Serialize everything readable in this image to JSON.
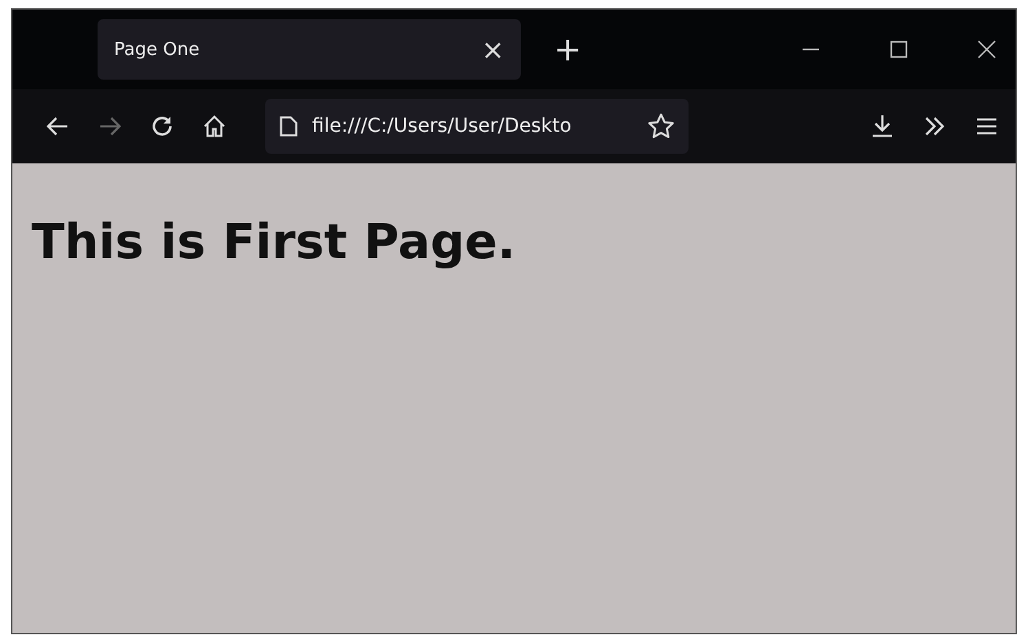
{
  "tab": {
    "title": "Page One",
    "selected": true,
    "close": "×"
  },
  "new_tab": "+",
  "toolbar": {
    "back_disabled": false,
    "forward_disabled": true,
    "url": "file:///C:/Users/User/Deskto"
  },
  "page": {
    "heading": "This is First Page."
  }
}
